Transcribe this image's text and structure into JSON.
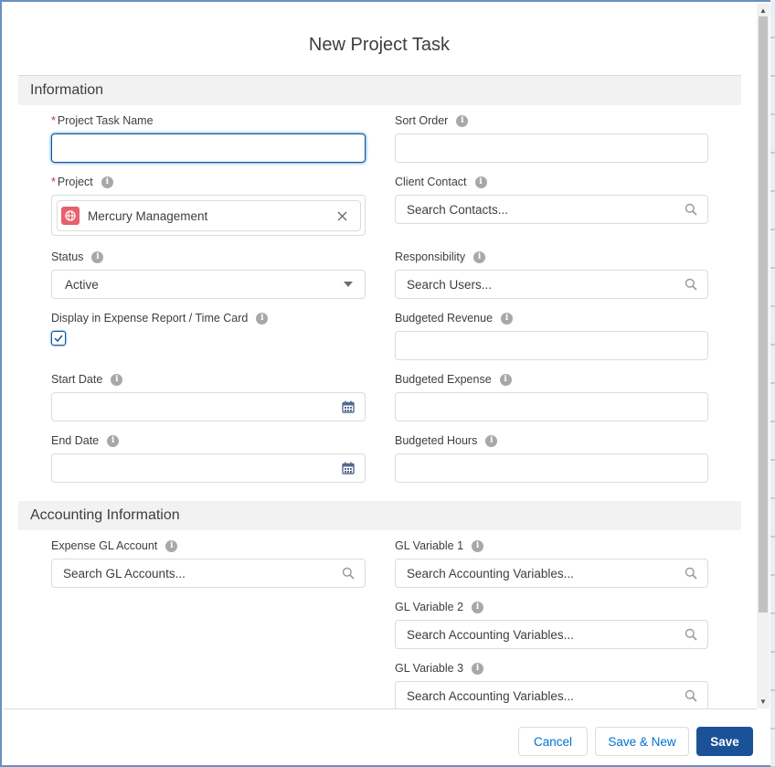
{
  "modal": {
    "title": "New Project Task"
  },
  "sections": {
    "information": "Information",
    "accounting": "Accounting Information"
  },
  "fields": {
    "project_task_name": {
      "label": "Project Task Name",
      "value": ""
    },
    "sort_order": {
      "label": "Sort Order",
      "value": ""
    },
    "project": {
      "label": "Project",
      "value": "Mercury Management"
    },
    "client_contact": {
      "label": "Client Contact",
      "placeholder": "Search Contacts..."
    },
    "status": {
      "label": "Status",
      "value": "Active"
    },
    "responsibility": {
      "label": "Responsibility",
      "placeholder": "Search Users..."
    },
    "display_expense": {
      "label": "Display in Expense Report / Time Card",
      "checked": true
    },
    "budgeted_revenue": {
      "label": "Budgeted Revenue",
      "value": ""
    },
    "start_date": {
      "label": "Start Date",
      "value": ""
    },
    "budgeted_expense": {
      "label": "Budgeted Expense",
      "value": ""
    },
    "end_date": {
      "label": "End Date",
      "value": ""
    },
    "budgeted_hours": {
      "label": "Budgeted Hours",
      "value": ""
    },
    "expense_gl_account": {
      "label": "Expense GL Account",
      "placeholder": "Search GL Accounts..."
    },
    "gl_variable_1": {
      "label": "GL Variable 1",
      "placeholder": "Search Accounting Variables..."
    },
    "gl_variable_2": {
      "label": "GL Variable 2",
      "placeholder": "Search Accounting Variables..."
    },
    "gl_variable_3": {
      "label": "GL Variable 3",
      "placeholder": "Search Accounting Variables..."
    }
  },
  "footer": {
    "cancel": "Cancel",
    "save_new": "Save & New",
    "save": "Save"
  },
  "colors": {
    "brand": "#1b5297",
    "link": "#0070d2",
    "required": "#c23934",
    "project_icon": "#e8606d"
  }
}
